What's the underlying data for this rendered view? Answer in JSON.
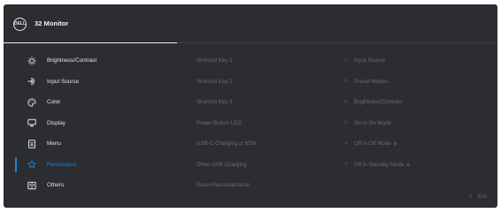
{
  "header": {
    "logo_text": "DELL",
    "title": "32 Monitor"
  },
  "colors": {
    "background": "#2b2d31",
    "active": "#1e7fd6",
    "text": "#e4e4e4",
    "dim_text": "#6a6c71"
  },
  "menu": {
    "items": [
      {
        "label": "Brightness/Contrast",
        "icon": "brightness-icon"
      },
      {
        "label": "Input Source",
        "icon": "input-source-icon"
      },
      {
        "label": "Color",
        "icon": "color-palette-icon"
      },
      {
        "label": "Display",
        "icon": "display-icon"
      },
      {
        "label": "Menu",
        "icon": "menu-icon"
      },
      {
        "label": "Personalize",
        "icon": "star-icon",
        "active": true
      },
      {
        "label": "Others",
        "icon": "others-icon"
      }
    ]
  },
  "options": [
    "Shortcut Key 1",
    "Shortcut Key 2",
    "Shortcut Key 3",
    "Power Button LED",
    "USB-C Charging ⇄ 65W",
    "Other USB Charging",
    "Reset Personalization"
  ],
  "values": [
    {
      "text": "Input Source",
      "chevron": ">",
      "extra": ""
    },
    {
      "text": "Preset Modes",
      "chevron": ">",
      "extra": ""
    },
    {
      "text": "Brightness/Contrast",
      "chevron": ">",
      "extra": ""
    },
    {
      "text": "On in On Mode",
      "chevron": ">",
      "extra": ""
    },
    {
      "text": "Off in Off Mode",
      "chevron": ">",
      "extra": "⌀"
    },
    {
      "text": "Off in Standby Mode",
      "chevron": ">",
      "extra": "⌀"
    }
  ],
  "footer": {
    "exit_chevron": "<",
    "exit_label": "Exit"
  }
}
